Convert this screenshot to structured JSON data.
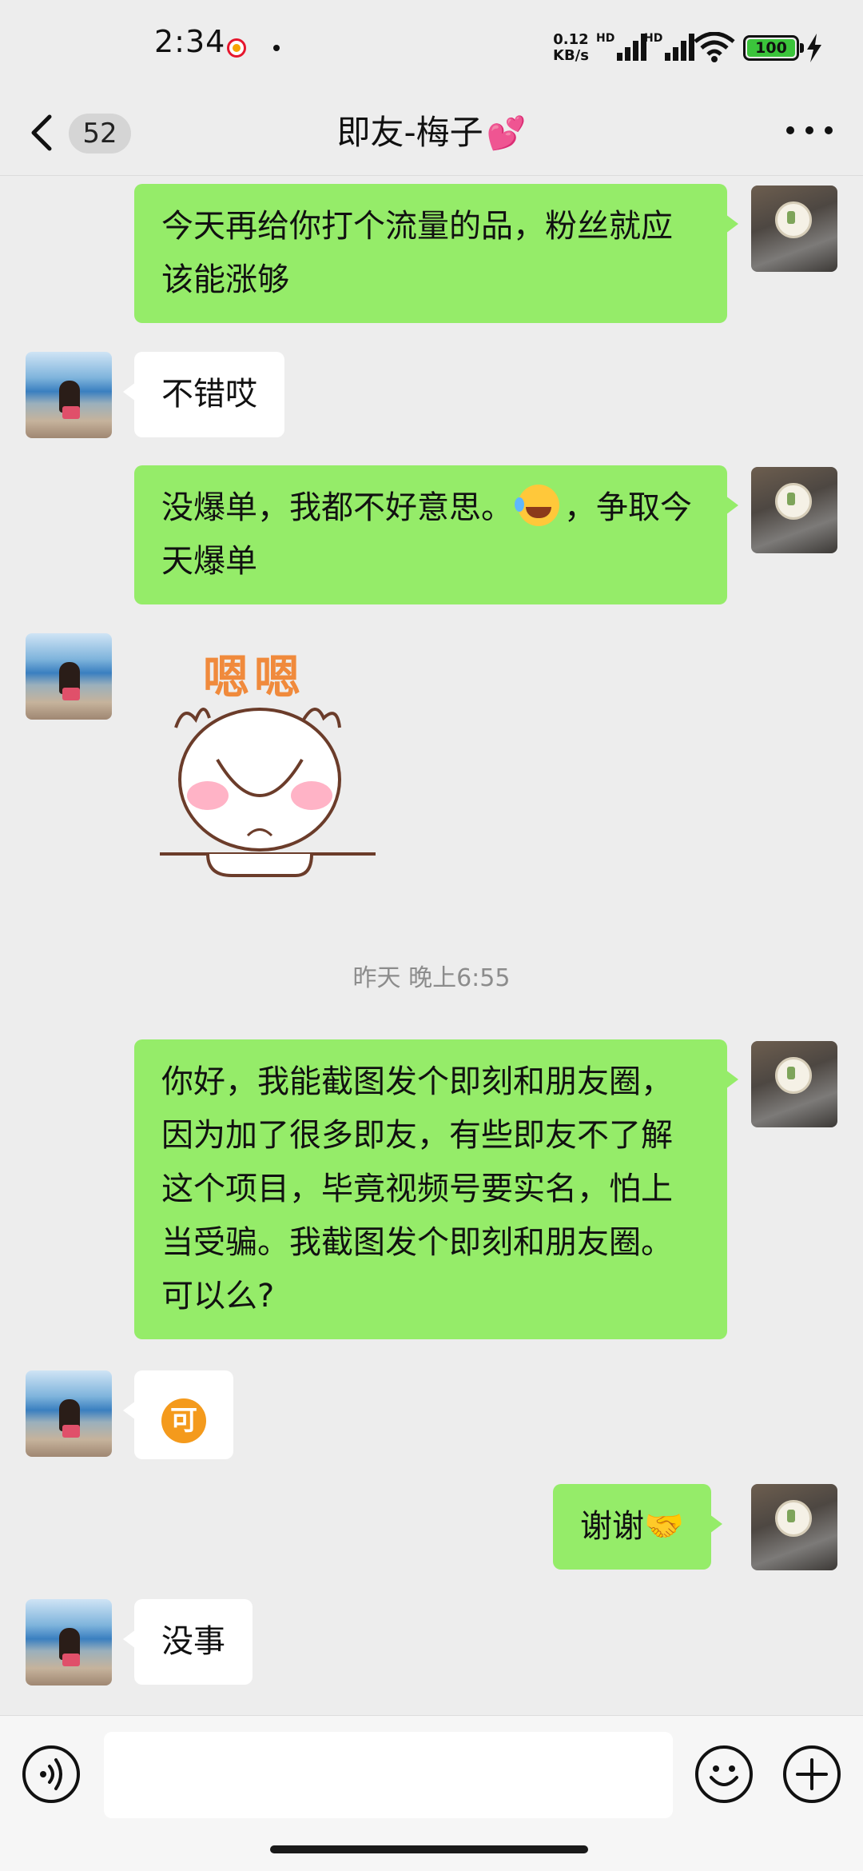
{
  "status_bar": {
    "time": "2:34",
    "net_speed_value": "0.12",
    "net_speed_unit": "KB/s",
    "signal1_label": "HD",
    "signal2_label": "HD",
    "battery": "100"
  },
  "header": {
    "unread_count": "52",
    "title": "即友-梅子",
    "title_icon": "two-hearts-icon"
  },
  "messages": [
    {
      "sender": "me",
      "text": "今天再给你打个流量的品，粉丝就应该能涨够"
    },
    {
      "sender": "friend",
      "text": "不错哎"
    },
    {
      "sender": "me",
      "text_before": "没爆单，我都不好意思。",
      "emoji": "laughing-crying-emoji",
      "text_after": "，争取今天爆单"
    },
    {
      "sender": "friend",
      "sticker": "嗯嗯"
    },
    {
      "timestamp": "昨天 晚上6:55"
    },
    {
      "sender": "me",
      "text": "你好，我能截图发个即刻和朋友圈，因为加了很多即友，有些即友不了解这个项目，毕竟视频号要实名，怕上当受骗。我截图发个即刻和朋友圈。可以么?"
    },
    {
      "sender": "friend",
      "badge_text": "可",
      "badge_color": "#f49a1c"
    },
    {
      "sender": "me",
      "text": "谢谢",
      "emoji": "handshake-emoji"
    },
    {
      "sender": "friend",
      "text": "没事"
    }
  ],
  "colors": {
    "my_bubble": "#95ec69",
    "friend_bubble": "#ffffff",
    "background": "#ededed"
  }
}
